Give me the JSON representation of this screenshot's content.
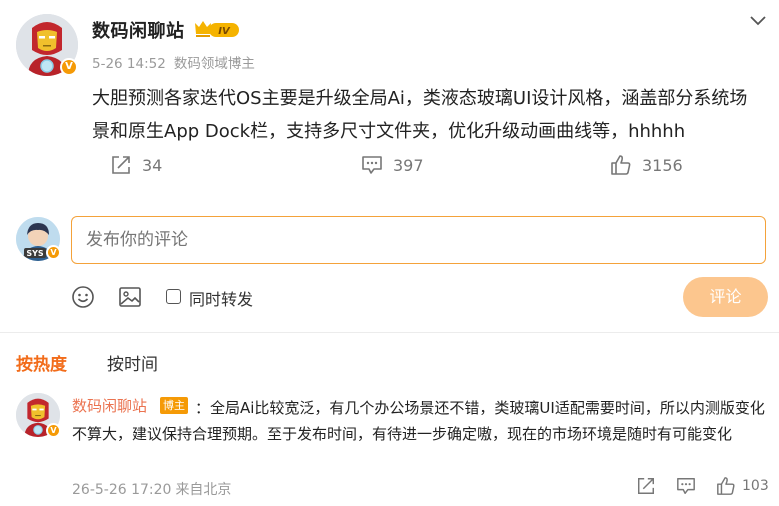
{
  "post": {
    "author": "数码闲聊站",
    "level": "IV",
    "verified_badge": "V",
    "time": "5-26 14:52",
    "source": "数码领域博主",
    "text": "大胆预测各家迭代OS主要是升级全局Ai，类液态玻璃UI设计风格，涵盖部分系统场景和原生App Dock栏，支持多尺寸文件夹，优化升级动画曲线等，hhhhh",
    "reposts": "34",
    "comments": "397",
    "likes": "3156"
  },
  "compose": {
    "placeholder": "发布你的评论",
    "repost_label": "同时转发",
    "submit_label": "评论",
    "avatar_text": "SYS"
  },
  "sort": {
    "hot": "按热度",
    "time": "按时间"
  },
  "comment": {
    "author": "数码闲聊站",
    "tag": "博主",
    "text": "：全局Ai比较宽泛，有几个办公场景还不错，类玻璃UI适配需要时间，所以内测版变化不算大，建议保持合理预期。至于发布时间，有待进一步确定嗷，现在的市场环境是随时有可能变化",
    "time": "26-5-26 17:20",
    "location": "来自北京",
    "likes": "103"
  },
  "colors": {
    "accent": "#f26c1a",
    "link": "#eb7350",
    "button": "#fcc68e",
    "badge": "#f59a06"
  },
  "icons": [
    "chevron-down-icon",
    "crown-level-icon",
    "repost-icon",
    "comment-icon",
    "like-icon",
    "emoji-icon",
    "image-icon"
  ]
}
